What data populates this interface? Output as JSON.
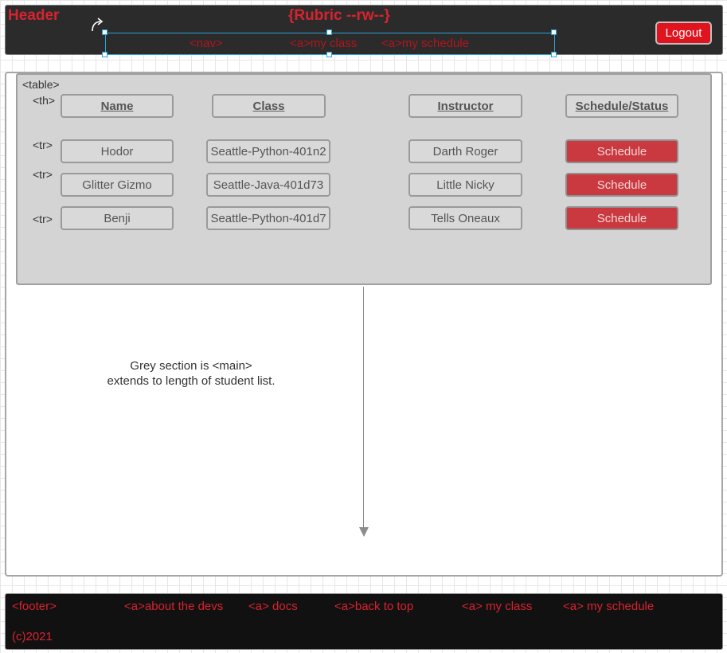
{
  "header": {
    "title": "Header",
    "center": "{Rubric --rw--}",
    "logout_label": "Logout",
    "nav": {
      "tag": "<nav>",
      "links": [
        "<a>my class",
        "<a>my schedule"
      ]
    }
  },
  "main": {
    "table_tag": "<table>",
    "th_tag": "<th>",
    "tr_tag": "<tr>",
    "columns": [
      "Name",
      "Class",
      "Instructor",
      "Schedule/Status"
    ],
    "rows": [
      {
        "name": "Hodor",
        "class": "Seattle-Python-401n2",
        "instructor": "Darth Roger",
        "action": "Schedule"
      },
      {
        "name": "Glitter Gizmo",
        "class": "Seattle-Java-401d73",
        "instructor": "Little Nicky",
        "action": "Schedule"
      },
      {
        "name": "Benji",
        "class": "Seattle-Python-401d7",
        "instructor": "Tells Oneaux",
        "action": "Schedule"
      }
    ],
    "note_line1": "Grey section is <main>",
    "note_line2": "extends to length of student list."
  },
  "footer": {
    "tag": "<footer>",
    "links": [
      "<a>about the devs",
      "<a> docs",
      "<a>back to top",
      "<a> my class",
      "<a> my schedule"
    ],
    "copyright": "(c)2021"
  },
  "colors": {
    "accent_red": "#d8232f",
    "header_bg": "#2b2b2b",
    "footer_bg": "#111111",
    "table_bg": "#d4d4d4",
    "schedule_button": "#c9393f"
  }
}
